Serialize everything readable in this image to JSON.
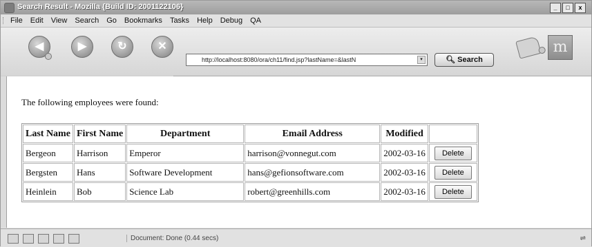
{
  "window": {
    "title": "Search Result - Mozilla {Build ID: 2001122106}",
    "controls": [
      "_",
      "□",
      "x"
    ]
  },
  "menubar": {
    "items": [
      "File",
      "Edit",
      "View",
      "Search",
      "Go",
      "Bookmarks",
      "Tasks",
      "Help",
      "Debug",
      "QA"
    ]
  },
  "navbar": {
    "url": "http://localhost:8080/ora/ch11/find.jsp?lastName=&lastN",
    "search_label": "Search",
    "logo": "m"
  },
  "page": {
    "intro": "The following employees were found:",
    "table": {
      "headers": [
        "Last Name",
        "First Name",
        "Department",
        "Email Address",
        "Modified",
        ""
      ],
      "rows": [
        {
          "last": "Bergeon",
          "first": "Harrison",
          "dept": "Emperor",
          "email": "harrison@vonnegut.com",
          "modified": "2002-03-16",
          "action": "Delete"
        },
        {
          "last": "Bergsten",
          "first": "Hans",
          "dept": "Software Development",
          "email": "hans@gefionsoftware.com",
          "modified": "2002-03-16",
          "action": "Delete"
        },
        {
          "last": "Heinlein",
          "first": "Bob",
          "dept": "Science Lab",
          "email": "robert@greenhills.com",
          "modified": "2002-03-16",
          "action": "Delete"
        }
      ]
    }
  },
  "statusbar": {
    "text": "Document: Done (0.44 secs)"
  }
}
